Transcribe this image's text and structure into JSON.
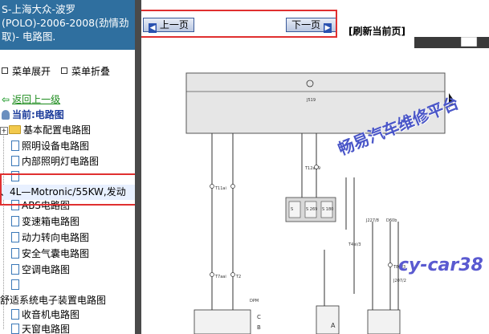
{
  "title": "S-上海大众-波罗(POLO)-2006-2008(劲情劲取)- 电路图.",
  "menu": {
    "expand_label": "菜单展开",
    "collapse_label": "菜单折叠"
  },
  "tree": {
    "back_label": "返回上一级",
    "current_label": "当前:电路图",
    "items": [
      {
        "label": "基本配置电路图",
        "type": "folder"
      },
      {
        "label": "照明设备电路图",
        "type": "doc"
      },
      {
        "label": "内部照明灯电路图",
        "type": "doc"
      },
      {
        "label": "",
        "type": "doc"
      },
      {
        "label": "、4L—Motronic/55KW,发动",
        "type": "selected"
      },
      {
        "label": "ABS电路图",
        "type": "doc"
      },
      {
        "label": "变速箱电路图",
        "type": "doc"
      },
      {
        "label": "动力转向电路图",
        "type": "doc"
      },
      {
        "label": "安全气囊电路图",
        "type": "doc"
      },
      {
        "label": "空调电路图",
        "type": "doc"
      },
      {
        "label": "",
        "type": "doc"
      },
      {
        "label": "舒适系统电子装置电路图",
        "type": "text"
      },
      {
        "label": "收音机电路图",
        "type": "doc"
      },
      {
        "label": "天窗电路图",
        "type": "doc"
      }
    ]
  },
  "nav": {
    "prev_label": "上一页",
    "next_label": "下一页",
    "refresh_label": "[刷新当前页]"
  },
  "diagram": {
    "watermark_cn": "畅易汽车维修平台",
    "watermark_en": "cy-car38",
    "watermark_en2": "r38",
    "labels": {
      "j519": "J519",
      "s_a": "S",
      "s_b": "S 269",
      "s_c": "S 180",
      "t11ai": "T11ai",
      "t12af": "T12af/9",
      "t7aai": "T7aai",
      "j227": "J227/8",
      "d60b": "D60b",
      "t8w": "T8w/3",
      "j207": "J207/2",
      "t4e": "T4ei/3",
      "t2": "T2",
      "a_lbl": "A",
      "c_lbl": "C",
      "b_lbl": "B",
      "dpm": "DPM"
    }
  },
  "colors": {
    "title_bg": "#2f6f9f",
    "highlight": "#e03030",
    "watermark": "#4a56c8"
  }
}
